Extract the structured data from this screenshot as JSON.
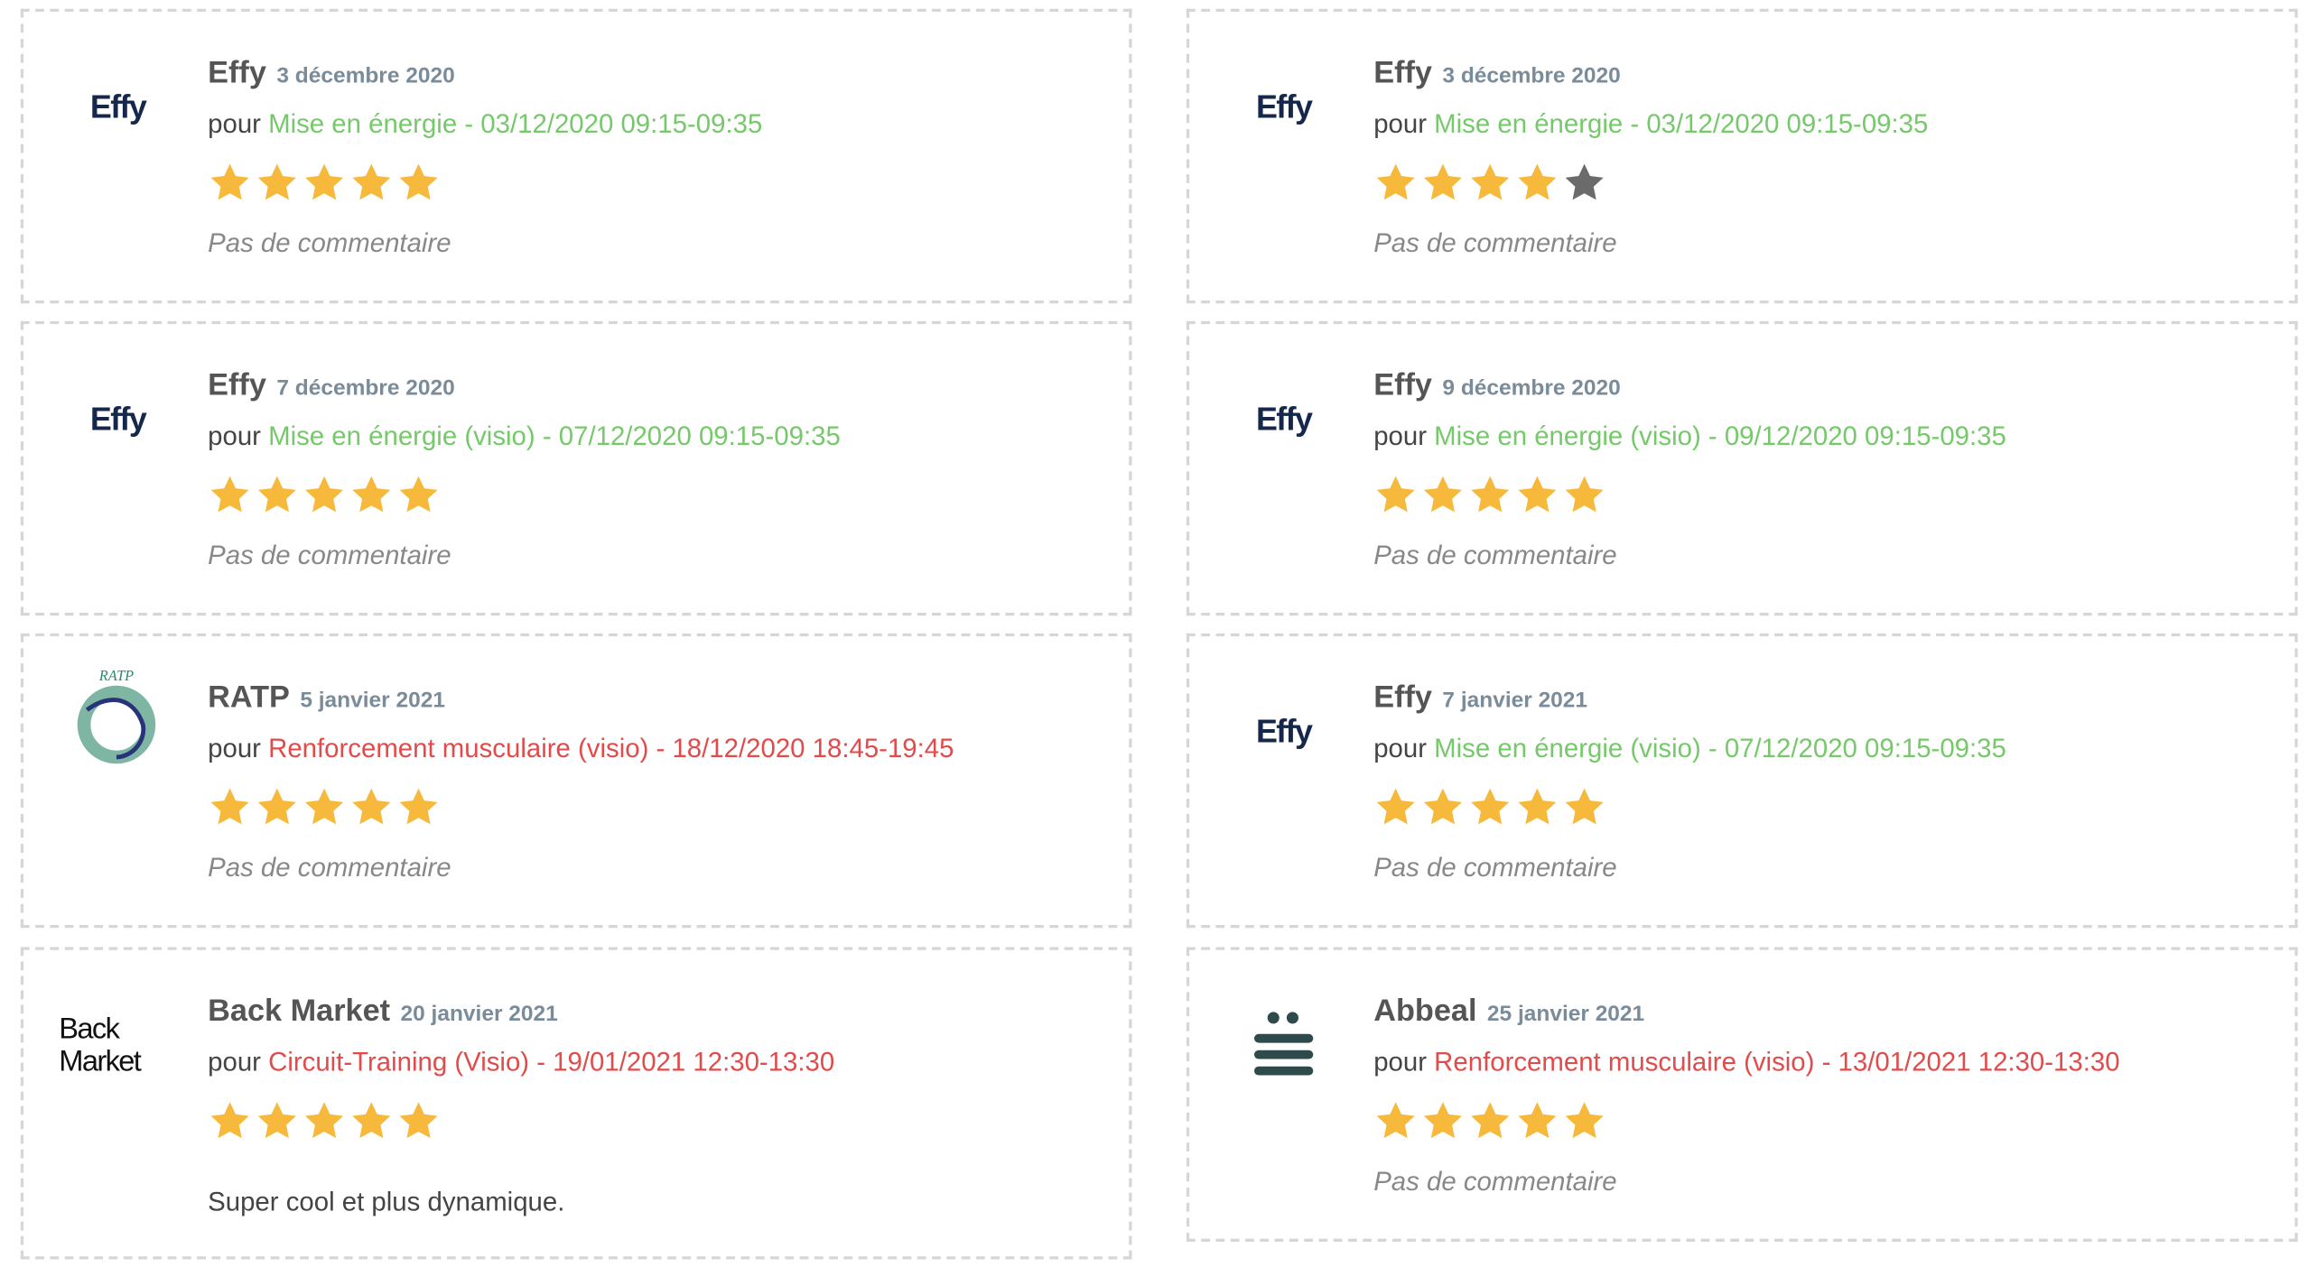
{
  "labels": {
    "pour": "pour"
  },
  "colors": {
    "star_filled": "#f6b93b",
    "star_empty": "#6b6b6b",
    "session_green": "#76c96a",
    "session_red": "#e24b4b"
  },
  "columns": [
    {
      "reviews": [
        {
          "logo": "effy-logo",
          "logo_text": "Effy",
          "company": "Effy",
          "date": "3 décembre 2020",
          "session": "Mise en énergie - 03/12/2020 09:15-09:35",
          "session_color": "green",
          "rating": 5,
          "comment": "Pas de commentaire",
          "has_comment": false
        },
        {
          "logo": "effy-logo",
          "logo_text": "Effy",
          "company": "Effy",
          "date": "7 décembre 2020",
          "session": "Mise en énergie (visio) - 07/12/2020 09:15-09:35",
          "session_color": "green",
          "rating": 5,
          "comment": "Pas de commentaire",
          "has_comment": false
        },
        {
          "logo": "ratp-logo",
          "logo_text": "RATP",
          "company": "RATP",
          "date": "5 janvier 2021",
          "session": "Renforcement musculaire (visio) - 18/12/2020 18:45-19:45",
          "session_color": "red",
          "rating": 5,
          "comment": "Pas de commentaire",
          "has_comment": false
        },
        {
          "logo": "backmarket-logo",
          "logo_text": "Back Market",
          "company": "Back Market",
          "date": "20 janvier 2021",
          "session": "Circuit-Training (Visio) - 19/01/2021 12:30-13:30",
          "session_color": "red",
          "rating": 5,
          "comment": "Super cool et plus dynamique.",
          "has_comment": true
        }
      ]
    },
    {
      "reviews": [
        {
          "logo": "effy-logo",
          "logo_text": "Effy",
          "company": "Effy",
          "date": "3 décembre 2020",
          "session": "Mise en énergie - 03/12/2020 09:15-09:35",
          "session_color": "green",
          "rating": 4,
          "comment": "Pas de commentaire",
          "has_comment": false
        },
        {
          "logo": "effy-logo",
          "logo_text": "Effy",
          "company": "Effy",
          "date": "9 décembre 2020",
          "session": "Mise en énergie (visio) - 09/12/2020 09:15-09:35",
          "session_color": "green",
          "rating": 5,
          "comment": "Pas de commentaire",
          "has_comment": false
        },
        {
          "logo": "effy-logo",
          "logo_text": "Effy",
          "company": "Effy",
          "date": "7 janvier 2021",
          "session": "Mise en énergie (visio) - 07/12/2020 09:15-09:35",
          "session_color": "green",
          "rating": 5,
          "comment": "Pas de commentaire",
          "has_comment": false
        },
        {
          "logo": "abbeal-logo",
          "company": "Abbeal",
          "date": "25 janvier 2021",
          "session": "Renforcement musculaire (visio) - 13/01/2021 12:30-13:30",
          "session_color": "red",
          "rating": 5,
          "comment": "Pas de commentaire",
          "has_comment": false
        }
      ]
    }
  ]
}
